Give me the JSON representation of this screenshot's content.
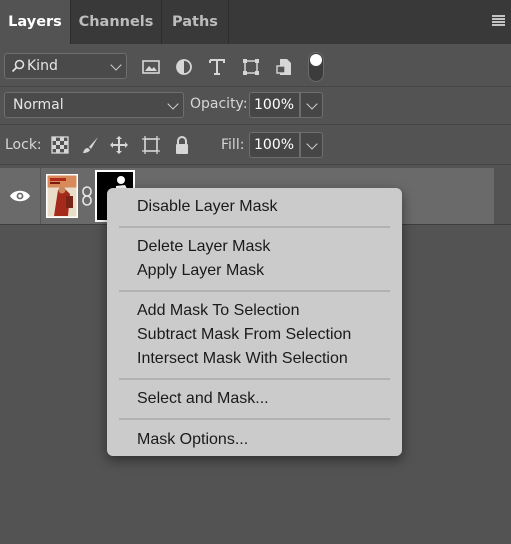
{
  "tabs": [
    {
      "label": "Layers",
      "active": true
    },
    {
      "label": "Channels",
      "active": false
    },
    {
      "label": "Paths",
      "active": false
    }
  ],
  "filter": {
    "kind_label": "Kind",
    "icons": [
      "image-filter-icon",
      "adjustment-filter-icon",
      "type-filter-icon",
      "shape-filter-icon",
      "smart-object-filter-icon",
      "filter-toggle-switch"
    ]
  },
  "blend": {
    "mode": "Normal",
    "opacity_label": "Opacity:",
    "opacity_value": "100%"
  },
  "lock": {
    "label": "Lock:",
    "fill_label": "Fill:",
    "fill_value": "100%",
    "icons": [
      "lock-transparent-pixels-icon",
      "lock-image-pixels-icon",
      "lock-position-icon",
      "lock-artboard-icon",
      "lock-all-icon"
    ]
  },
  "layer": {
    "visible": true,
    "thumbnail_icon": "poster-thumbnail",
    "mask_thumbnail_icon": "silhouette-mask-thumbnail"
  },
  "context_menu": {
    "items": [
      "Disable Layer Mask",
      "Delete Layer Mask",
      "Apply Layer Mask",
      "Add Mask To Selection",
      "Subtract Mask From Selection",
      "Intersect Mask With Selection",
      "Select and Mask...",
      "Mask Options..."
    ]
  },
  "colors": {
    "panel_bg": "#535353",
    "tabbar_bg": "#393939",
    "menu_bg": "#cbcbcb",
    "selected_layer_bg": "#6a6a6a"
  }
}
